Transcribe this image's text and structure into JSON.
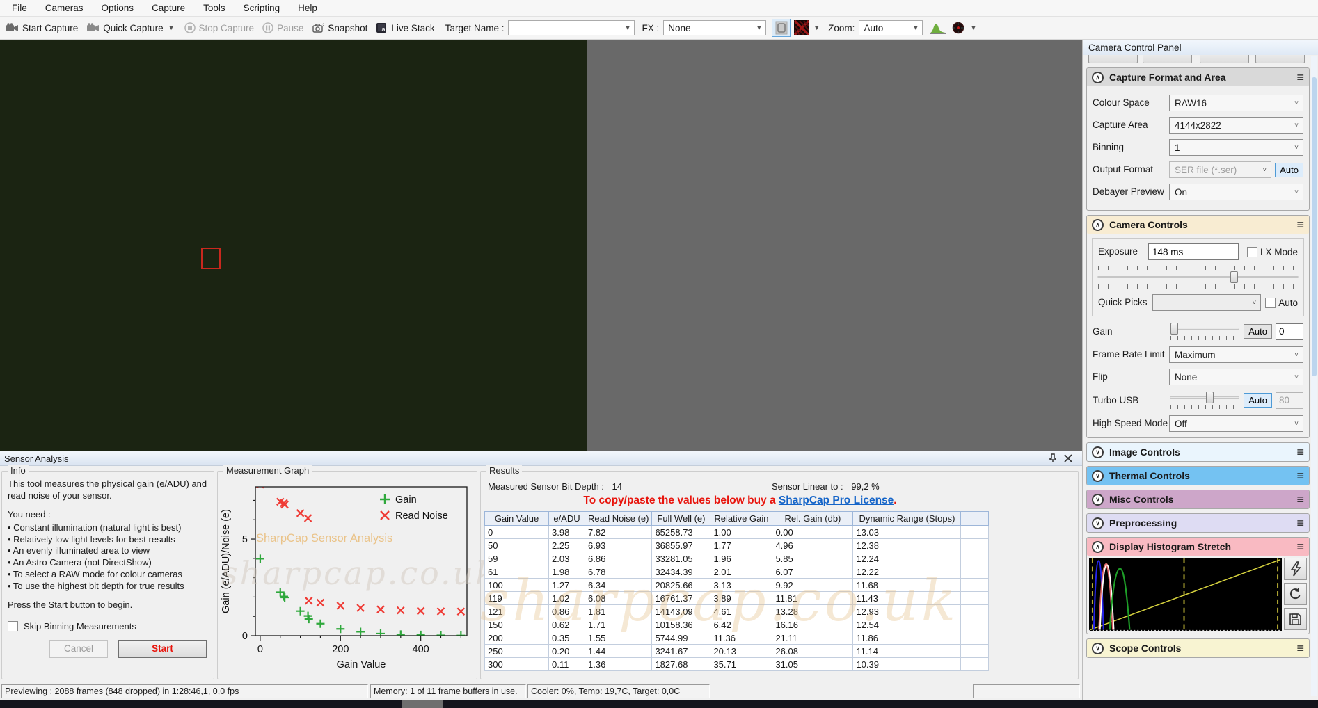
{
  "menu": {
    "items": [
      "File",
      "Cameras",
      "Options",
      "Capture",
      "Tools",
      "Scripting",
      "Help"
    ]
  },
  "toolbar": {
    "start_capture": "Start Capture",
    "quick_capture": "Quick Capture",
    "stop_capture": "Stop Capture",
    "pause": "Pause",
    "snapshot": "Snapshot",
    "live_stack": "Live Stack",
    "target_name_label": "Target Name :",
    "target_name_value": "",
    "fx_label": "FX :",
    "fx_value": "None",
    "zoom_label": "Zoom:",
    "zoom_value": "Auto"
  },
  "camera_panel": {
    "title": "Camera Control Panel",
    "capture_format": {
      "title": "Capture Format and Area",
      "header_color": "#d9d9d9",
      "colour_space_label": "Colour Space",
      "colour_space_value": "RAW16",
      "capture_area_label": "Capture Area",
      "capture_area_value": "4144x2822",
      "binning_label": "Binning",
      "binning_value": "1",
      "output_format_label": "Output Format",
      "output_format_value": "SER file (*.ser)",
      "output_auto_label": "Auto",
      "debayer_label": "Debayer Preview",
      "debayer_value": "On"
    },
    "camera_controls": {
      "title": "Camera Controls",
      "header_color": "#f8ecd2",
      "exposure_label": "Exposure",
      "exposure_value": "148 ms",
      "lx_mode_label": "LX Mode",
      "quick_picks_label": "Quick Picks",
      "quick_picks_value": "",
      "quick_picks_auto_label": "Auto",
      "gain_label": "Gain",
      "gain_auto_label": "Auto",
      "gain_value": "0",
      "frame_rate_label": "Frame Rate Limit",
      "frame_rate_value": "Maximum",
      "flip_label": "Flip",
      "flip_value": "None",
      "turbo_usb_label": "Turbo USB",
      "turbo_auto_label": "Auto",
      "turbo_value": "80",
      "high_speed_label": "High Speed Mode",
      "high_speed_value": "Off"
    },
    "collapsed_sections": [
      {
        "title": "Image Controls",
        "color": "#eaf5fd"
      },
      {
        "title": "Thermal Controls",
        "color": "#74c2f2"
      },
      {
        "title": "Misc Controls",
        "color": "#cda6c9"
      },
      {
        "title": "Preprocessing",
        "color": "#dedcf3"
      }
    ],
    "histogram_section": {
      "title": "Display Histogram Stretch",
      "color": "#f9bac2"
    },
    "scope_section": {
      "title": "Scope Controls",
      "color": "#f8f4d2"
    }
  },
  "sensor_analysis": {
    "title": "Sensor Analysis",
    "info": {
      "group_label": "Info",
      "intro": "This tool measures the physical gain (e/ADU) and read noise of your sensor.",
      "need_label": "You need :",
      "bullets": [
        "• Constant illumination (natural light is best)",
        "• Relatively low light levels for best results",
        "• An evenly illuminated area to view",
        "• An Astro Camera (not DirectShow)",
        "• To select a RAW mode for colour cameras",
        "• To use the highest bit depth for true results"
      ],
      "press": "Press the Start button to begin.",
      "skip_label": "Skip Binning Measurements",
      "cancel_label": "Cancel",
      "start_label": "Start"
    },
    "graph_group_label": "Measurement Graph",
    "graph_watermark_line1": "SharpCap Sensor Analysis",
    "graph_watermark_line2": "sharpcap.co.uk",
    "results": {
      "group_label": "Results",
      "bit_depth_label": "Measured Sensor Bit Depth :",
      "bit_depth_value": "14",
      "linear_label": "Sensor Linear to :",
      "linear_value": "99,2 %",
      "license_prefix": "To copy/paste the values below buy a ",
      "license_link": "SharpCap Pro License",
      "license_suffix": ".",
      "watermark": "sharpcap.co.uk",
      "table": {
        "headers": [
          "Gain Value",
          "e/ADU",
          "Read Noise (e)",
          "Full Well (e)",
          "Relative Gain",
          "Rel. Gain (db)",
          "Dynamic Range (Stops)",
          ""
        ],
        "rows": [
          [
            "0",
            "3.98",
            "7.82",
            "65258.73",
            "1.00",
            "0.00",
            "13.03",
            ""
          ],
          [
            "50",
            "2.25",
            "6.93",
            "36855.97",
            "1.77",
            "4.96",
            "12.38",
            ""
          ],
          [
            "59",
            "2.03",
            "6.86",
            "33281.05",
            "1.96",
            "5.85",
            "12.24",
            ""
          ],
          [
            "61",
            "1.98",
            "6.78",
            "32434.39",
            "2.01",
            "6.07",
            "12.22",
            ""
          ],
          [
            "100",
            "1.27",
            "6.34",
            "20825.66",
            "3.13",
            "9.92",
            "11.68",
            ""
          ],
          [
            "119",
            "1.02",
            "6.08",
            "16761.37",
            "3.89",
            "11.81",
            "11.43",
            ""
          ],
          [
            "121",
            "0.86",
            "1.81",
            "14143.09",
            "4.61",
            "13.28",
            "12.93",
            ""
          ],
          [
            "150",
            "0.62",
            "1.71",
            "10158.36",
            "6.42",
            "16.16",
            "12.54",
            ""
          ],
          [
            "200",
            "0.35",
            "1.55",
            "5744.99",
            "11.36",
            "21.11",
            "11.86",
            ""
          ],
          [
            "250",
            "0.20",
            "1.44",
            "3241.67",
            "20.13",
            "26.08",
            "11.14",
            ""
          ],
          [
            "300",
            "0.11",
            "1.36",
            "1827.68",
            "35.71",
            "31.05",
            "10.39",
            ""
          ]
        ]
      }
    }
  },
  "chart_data": {
    "type": "scatter",
    "title": "",
    "xlabel": "Gain Value",
    "ylabel": "Gain (e/ADU)/Noise (e)",
    "xlim": [
      -12,
      515
    ],
    "ylim": [
      0,
      7.7
    ],
    "xticks_major": [
      0,
      200,
      400
    ],
    "xtick_minor_step": 50,
    "yticks_major": [
      0,
      5
    ],
    "ytick_minor_step": 1,
    "grid": false,
    "legend_position": "top-right",
    "series": [
      {
        "name": "Gain",
        "marker": "plus",
        "color": "#2fa83c",
        "x": [
          0,
          50,
          59,
          61,
          100,
          119,
          121,
          150,
          200,
          250,
          300,
          350,
          400,
          450,
          500
        ],
        "y": [
          3.98,
          2.25,
          2.03,
          1.98,
          1.27,
          1.02,
          0.86,
          0.62,
          0.35,
          0.2,
          0.11,
          0.06,
          0.04,
          0.02,
          0.01
        ]
      },
      {
        "name": "Read Noise",
        "marker": "x",
        "color": "#ef3b35",
        "x": [
          0,
          50,
          59,
          61,
          100,
          119,
          121,
          150,
          200,
          250,
          300,
          350,
          400,
          450,
          500
        ],
        "y": [
          7.82,
          6.93,
          6.86,
          6.78,
          6.34,
          6.08,
          1.81,
          1.71,
          1.55,
          1.44,
          1.36,
          1.31,
          1.28,
          1.26,
          1.25
        ]
      }
    ]
  },
  "status_bar": {
    "sections": [
      "Previewing : 2088 frames (848 dropped) in 1:28:46,1, 0,0 fps",
      "Memory: 1 of 11 frame buffers in use.",
      "Cooler: 0%, Temp: 19,7C, Target: 0,0C"
    ]
  },
  "colors": {
    "preview_bg": "#1b2412",
    "roi_red": "#c9281e",
    "license_red": "#e8140c",
    "link_blue": "#1464c8",
    "thermal_blue": "#74c2f2",
    "histogram_pink": "#f9bac2"
  }
}
